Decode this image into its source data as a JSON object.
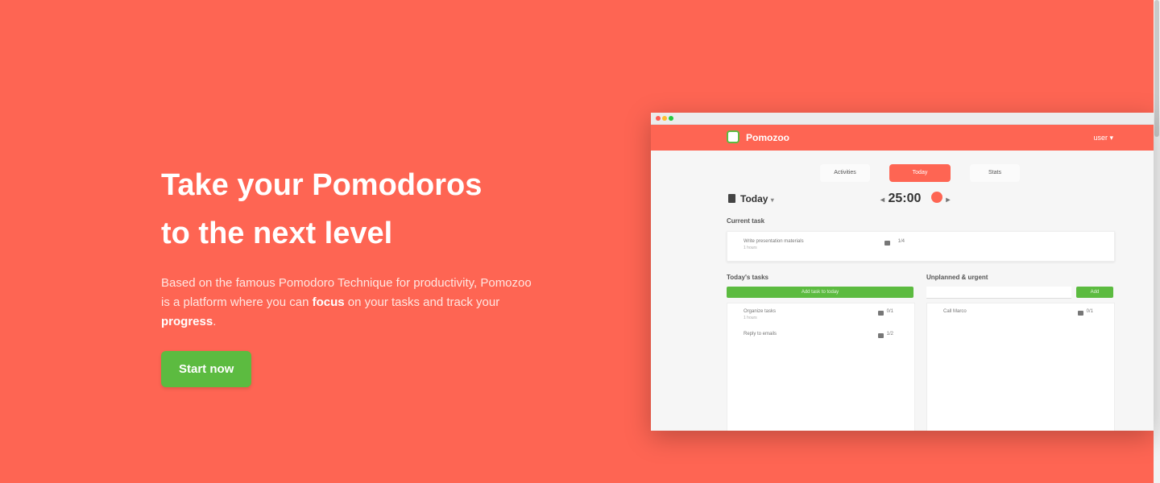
{
  "hero": {
    "title_line1": "Take your Pomodoros",
    "title_line2": "to the next level",
    "desc_prefix": "Based on the famous Pomodoro Technique for productivity, Pomozoo is a platform where you can ",
    "desc_focus": "focus",
    "desc_middle": " on your tasks and track your ",
    "desc_progress": "progress",
    "desc_suffix": ".",
    "cta_label": "Start now"
  },
  "mockup": {
    "app_name": "Pomozoo",
    "user_menu": "user ▾",
    "nav_tabs": [
      "Activities",
      "Today",
      "Stats"
    ],
    "active_tab": "Today",
    "today_label": "Today",
    "timer_value": "25:00",
    "current_task_label": "Current task",
    "current_task": {
      "title": "Write presentation materials",
      "sub": "1 hours",
      "count": "1/4"
    },
    "todays_tasks_label": "Today's tasks",
    "add_task_label": "Add task to today",
    "todays_tasks": [
      {
        "title": "Organize tasks",
        "sub": "1 hours",
        "count": "0/1"
      },
      {
        "title": "Reply to emails",
        "sub": "",
        "count": "1/2"
      }
    ],
    "unplanned_label": "Unplanned & urgent",
    "add_urgent_label": "Add",
    "unplanned_tasks": [
      {
        "title": "Call Marco",
        "count": "0/1"
      }
    ]
  },
  "colors": {
    "brand": "#fe6553",
    "cta": "#5cbb40"
  }
}
